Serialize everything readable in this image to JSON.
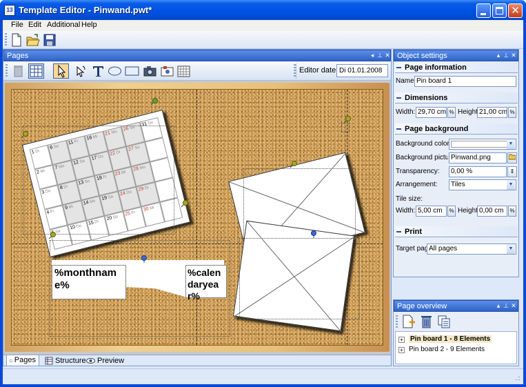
{
  "window": {
    "title": "Template Editor - Pinwand.pwt*",
    "app_icon_text": "13"
  },
  "menu": {
    "items": [
      {
        "label": "File",
        "key": "F"
      },
      {
        "label": "Edit",
        "key": "E"
      },
      {
        "label": "Additional",
        "key": "A"
      },
      {
        "label": "Help",
        "key": "H"
      }
    ]
  },
  "toolbar": {
    "buttons": [
      "new-document-icon",
      "open-folder-icon",
      "save-disk-icon"
    ]
  },
  "pages_panel": {
    "title": "Pages",
    "editor_date_label": "Editor date:",
    "editor_date_value": "Di 01.01.2008",
    "tools": [
      "delete-icon",
      "grid-icon",
      "pointer-icon",
      "rotate-icon",
      "text-icon",
      "ellipse-icon",
      "rectangle-icon",
      "photo-icon",
      "image-frame-icon",
      "calendar-icon"
    ],
    "tabs": [
      {
        "label": "Pages",
        "active": true
      },
      {
        "label": "Structure",
        "active": false
      },
      {
        "label": "Preview",
        "active": false
      }
    ]
  },
  "canvas": {
    "placeholder_month": "%monthname%",
    "placeholder_year": "%calendaryear%",
    "calendar_numbers": [
      "1",
      "2",
      "3",
      "4",
      "5",
      "6",
      "7",
      "8",
      "9",
      "10",
      "11",
      "12",
      "13",
      "14",
      "15",
      "16",
      "17",
      "18",
      "19",
      "20",
      "21",
      "22",
      "23",
      "24",
      "25",
      "26",
      "27",
      "28",
      "29",
      "30",
      "31"
    ],
    "calendar_days": [
      "Di",
      "Mi",
      "Do",
      "Fr",
      "Sa",
      "So",
      "Mo"
    ],
    "highlight_color": "#c0392b"
  },
  "object_settings": {
    "title": "Object settings",
    "page_info": {
      "heading": "Page information",
      "name_label": "Name:",
      "name_value": "Pin board 1"
    },
    "dimensions": {
      "heading": "Dimensions",
      "width_label": "Width:",
      "width_value": "29,70 cm",
      "height_label": "Height:",
      "height_value": "21,00 cm"
    },
    "background": {
      "heading": "Page background",
      "color_label": "Background color:",
      "color_value": "#ffffff",
      "picture_label": "Background picture:",
      "picture_value": "Pinwand.png",
      "transparency_label": "Transparency:",
      "transparency_value": "0,00 %",
      "arrangement_label": "Arrangement:",
      "arrangement_value": "Tiles",
      "tile_size_label": "Tile size:",
      "tile_width_label": "Width:",
      "tile_width_value": "5,00 cm",
      "tile_height_label": "Height:",
      "tile_height_value": "0,00 cm"
    },
    "print": {
      "heading": "Print",
      "target_label": "Target page:",
      "target_value": "All pages"
    }
  },
  "page_overview": {
    "title": "Page overview",
    "tools": [
      "add-page-icon",
      "delete-page-icon",
      "copy-page-icon"
    ],
    "items": [
      {
        "label": "Pin board 1 - 8 Elements",
        "selected": true
      },
      {
        "label": "Pin board 2 - 9 Elements",
        "selected": false
      }
    ]
  },
  "colors": {
    "title_bar": "#0054e3",
    "panel_header": "#2f64c8",
    "panel_bg": "#e8eef8",
    "cork": "#c89a55",
    "frame": "#e8c078"
  }
}
